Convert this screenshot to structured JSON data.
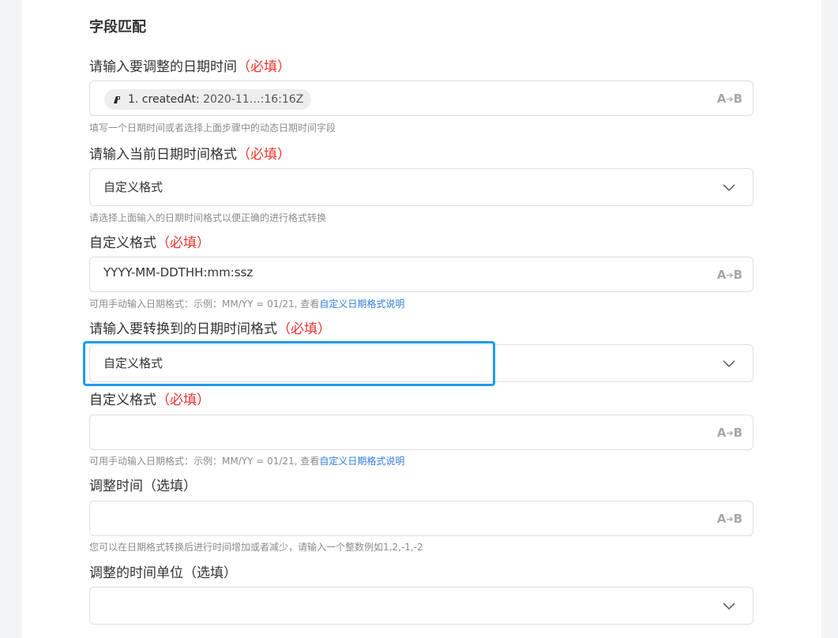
{
  "section_title": "字段匹配",
  "required_mark": "（必填）",
  "fields": {
    "input_datetime": {
      "label": "请输入要调整的日期时间",
      "chip": {
        "step": "1. createdAt:",
        "value": "2020-11…:16:16Z",
        "icon": "step-app-icon"
      },
      "help": "填写一个日期时间或者选择上面步骤中的动态日期时间字段",
      "mode_icon": "A➔B"
    },
    "current_format": {
      "label": "请输入当前日期时间格式",
      "value": "自定义格式",
      "help": "请选择上面输入的日期时间格式以便正确的进行格式转换"
    },
    "custom_format_1": {
      "label": "自定义格式",
      "value": "YYYY-MM-DDTHH:mm:ssz",
      "help_prefix": "可用手动输入日期格式：示例：MM/YY = 01/21, 查看",
      "help_link": "自定义日期格式说明",
      "mode_icon": "A➔B"
    },
    "target_format": {
      "label": "请输入要转换到的日期时间格式",
      "value": "自定义格式"
    },
    "custom_format_2": {
      "label": "自定义格式",
      "value": "",
      "help_prefix": "可用手动输入日期格式：示例：MM/YY = 01/21, 查看",
      "help_link": "自定义日期格式说明",
      "mode_icon": "A➔B"
    },
    "adjust_time": {
      "label": "调整时间（选填）",
      "value": "",
      "help": "您可以在日期格式转换后进行时间增加或者减少，请输入一个整数例如1,2,-1,-2",
      "mode_icon": "A➔B"
    },
    "adjust_unit": {
      "label": "调整的时间单位（选填）",
      "value": ""
    }
  },
  "colors": {
    "required": "#e8332b",
    "link": "#2f7de1",
    "focus": "#1e9bf0"
  }
}
